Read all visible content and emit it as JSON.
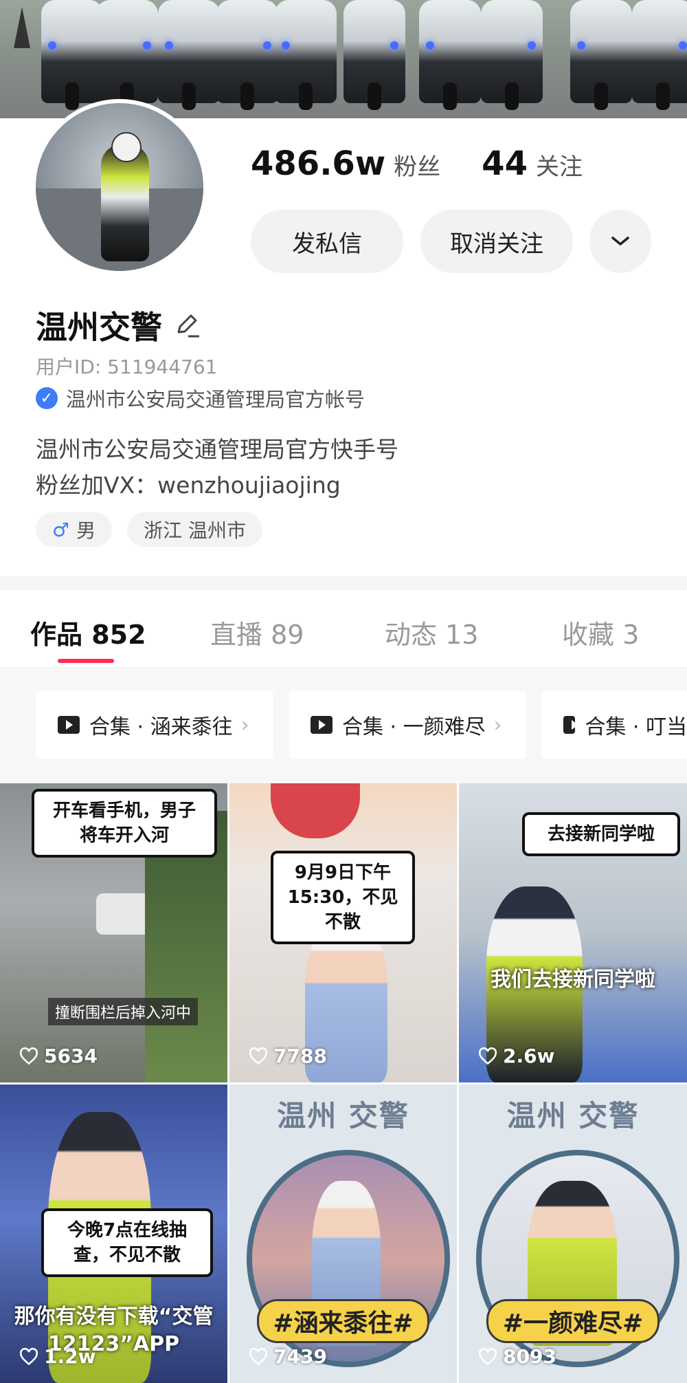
{
  "profile": {
    "followers_count": "486.6w",
    "followers_label": "粉丝",
    "following_count": "44",
    "following_label": "关注",
    "message_button": "发私信",
    "unfollow_button": "取消关注",
    "name": "温州交警",
    "user_id": "用户ID: 511944761",
    "verification": "温州市公安局交通管理局官方帐号",
    "bio_line1": "温州市公安局交通管理局官方快手号",
    "bio_line2": "粉丝加VX：wenzhoujiaojing",
    "tag_gender": "男",
    "tag_location": "浙江 温州市"
  },
  "tabs": [
    {
      "label": "作品 852"
    },
    {
      "label": "直播 89"
    },
    {
      "label": "动态 13"
    },
    {
      "label": "收藏 3"
    }
  ],
  "collections": [
    {
      "label": "合集 · 涵来黍往"
    },
    {
      "label": "合集 · 一颜难尽"
    },
    {
      "label": "合集 · 叮当"
    }
  ],
  "videos": [
    {
      "bubble": "开车看手机，男子将车开入河",
      "caption": "撞断围栏后掉入河中",
      "likes": "5634"
    },
    {
      "bubble": "9月9日下午15:30，不见不散",
      "caption": "",
      "likes": "7788"
    },
    {
      "bubble": "去接新同学啦",
      "caption": "我们去接新同学啦",
      "likes": "2.6w"
    },
    {
      "bubble": "今晚7点在线抽查，不见不散",
      "caption": "那你有没有下载“交管12123”APP",
      "likes": "1.2w"
    },
    {
      "title": "温州  交警",
      "hashtag": "#涵来黍往#",
      "likes": "7439"
    },
    {
      "title": "温州  交警",
      "hashtag": "#一颜难尽#",
      "likes": "8093"
    }
  ],
  "colors": {
    "accent": "#fe2c55",
    "verify_blue": "#3f7df6"
  }
}
